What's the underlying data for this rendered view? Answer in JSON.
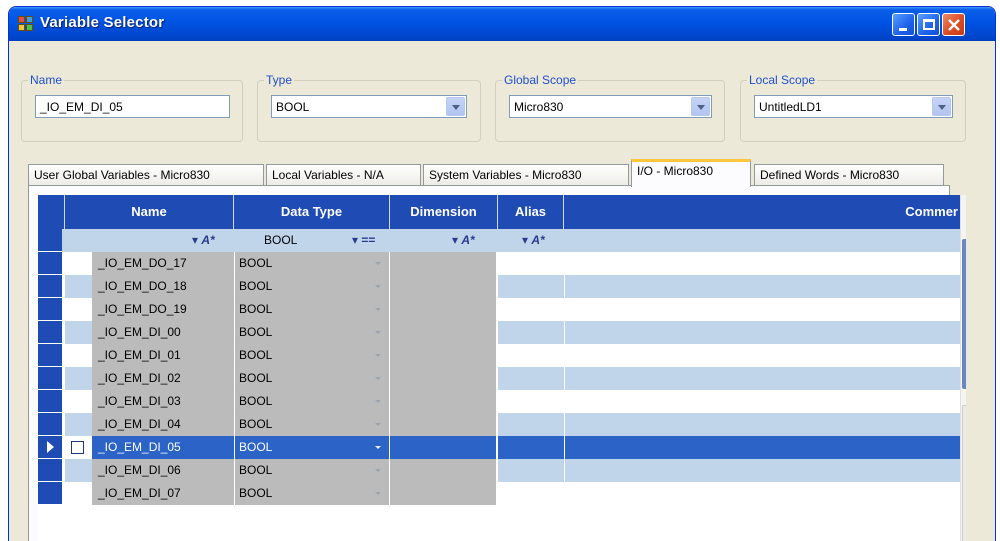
{
  "window": {
    "title": "Variable Selector",
    "controls": [
      "minimize-icon",
      "maximize-icon",
      "close-icon"
    ]
  },
  "fields": {
    "name": {
      "label": "Name",
      "value": "_IO_EM_DI_05"
    },
    "type": {
      "label": "Type",
      "value": "BOOL"
    },
    "global_scope": {
      "label": "Global Scope",
      "value": "Micro830"
    },
    "local_scope": {
      "label": "Local Scope",
      "value": "UntitledLD1"
    }
  },
  "tabs": [
    {
      "label": "User Global Variables - Micro830",
      "active": false
    },
    {
      "label": "Local Variables - N/A",
      "active": false
    },
    {
      "label": "System Variables - Micro830",
      "active": false
    },
    {
      "label": "I/O - Micro830",
      "active": true
    },
    {
      "label": "Defined Words - Micro830",
      "active": false
    }
  ],
  "grid": {
    "columns": [
      "Name",
      "Data Type",
      "Dimension",
      "Alias",
      "Commer"
    ],
    "filter": {
      "data_type": "BOOL",
      "name_filter_icon": "filter-icon",
      "eq_icon": "equals-icon"
    },
    "rows": [
      {
        "name": "_IO_EM_DO_17",
        "type": "BOOL",
        "selected": false
      },
      {
        "name": "_IO_EM_DO_18",
        "type": "BOOL",
        "selected": false
      },
      {
        "name": "_IO_EM_DO_19",
        "type": "BOOL",
        "selected": false
      },
      {
        "name": "_IO_EM_DI_00",
        "type": "BOOL",
        "selected": false
      },
      {
        "name": "_IO_EM_DI_01",
        "type": "BOOL",
        "selected": false
      },
      {
        "name": "_IO_EM_DI_02",
        "type": "BOOL",
        "selected": false
      },
      {
        "name": "_IO_EM_DI_03",
        "type": "BOOL",
        "selected": false
      },
      {
        "name": "_IO_EM_DI_04",
        "type": "BOOL",
        "selected": false
      },
      {
        "name": "_IO_EM_DI_05",
        "type": "BOOL",
        "selected": true
      },
      {
        "name": "_IO_EM_DI_06",
        "type": "BOOL",
        "selected": false
      },
      {
        "name": "_IO_EM_DI_07",
        "type": "BOOL",
        "selected": false
      }
    ]
  },
  "colors": {
    "header_blue": "#1f4bb5",
    "selected_row": "#2b64c6",
    "alt_row": "#c0d4ea",
    "locked_cell": "#bbbbbb",
    "group_label": "#1f4fcc"
  }
}
